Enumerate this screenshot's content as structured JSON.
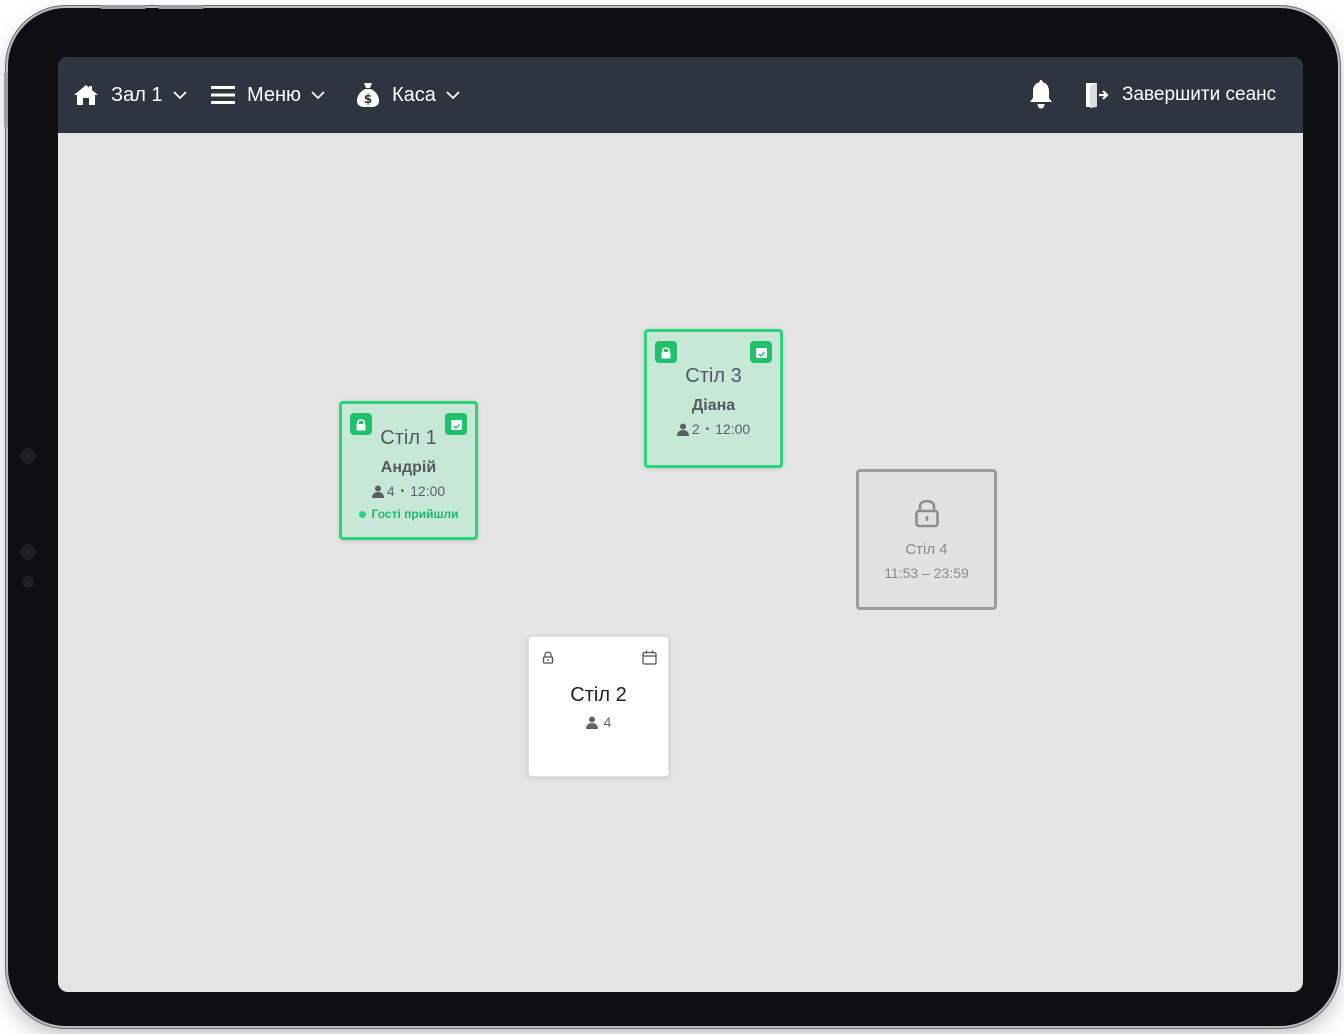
{
  "topbar": {
    "hall_label": "Зал 1",
    "menu_label": "Меню",
    "cash_label": "Каса",
    "end_session_label": "Завершити сеанс"
  },
  "tables": [
    {
      "name": "Стіл 1",
      "status": "busy",
      "guest": "Андрій",
      "guests": "4",
      "time": "12:00",
      "status_text": "Гості прийшли"
    },
    {
      "name": "Стіл 3",
      "status": "busy",
      "guest": "Діана",
      "guests": "2",
      "time": "12:00"
    },
    {
      "name": "Стіл 4",
      "status": "blocked",
      "time_range": "11:53 – 23:59"
    },
    {
      "name": "Стіл 2",
      "status": "free",
      "guests": "4"
    }
  ],
  "colors": {
    "topbar": "#2e3440",
    "floor": "#e4e4e4",
    "busy_fill": "#c8e8d7",
    "busy_border": "#2ad37c",
    "blocked_border": "#9c9c9c"
  }
}
